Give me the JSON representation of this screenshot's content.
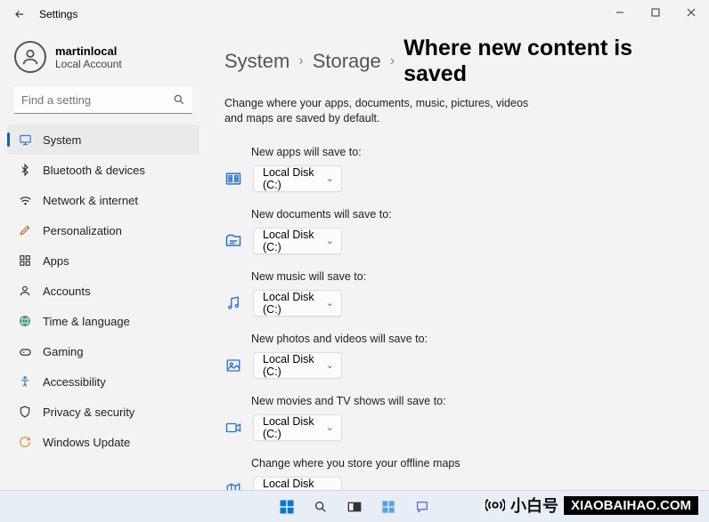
{
  "titlebar": {
    "title": "Settings"
  },
  "user": {
    "name": "martinlocal",
    "type": "Local Account"
  },
  "search": {
    "placeholder": "Find a setting"
  },
  "nav": [
    {
      "label": "System",
      "selected": true
    },
    {
      "label": "Bluetooth & devices"
    },
    {
      "label": "Network & internet"
    },
    {
      "label": "Personalization"
    },
    {
      "label": "Apps"
    },
    {
      "label": "Accounts"
    },
    {
      "label": "Time & language"
    },
    {
      "label": "Gaming"
    },
    {
      "label": "Accessibility"
    },
    {
      "label": "Privacy & security"
    },
    {
      "label": "Windows Update"
    }
  ],
  "breadcrumb": {
    "a": "System",
    "b": "Storage",
    "title": "Where new content is saved"
  },
  "description": "Change where your apps, documents, music, pictures, videos and maps are saved by default.",
  "settings": [
    {
      "label": "New apps will save to:",
      "value": "Local Disk (C:)"
    },
    {
      "label": "New documents will save to:",
      "value": "Local Disk (C:)"
    },
    {
      "label": "New music will save to:",
      "value": "Local Disk (C:)"
    },
    {
      "label": "New photos and videos will save to:",
      "value": "Local Disk (C:)"
    },
    {
      "label": "New movies and TV shows will save to:",
      "value": "Local Disk (C:)"
    },
    {
      "label": "Change where you store your offline maps",
      "value": "Local Disk (C:)"
    }
  ],
  "watermark": {
    "cn": "小白号",
    "url": "XIAOBAIHAO.COM"
  }
}
